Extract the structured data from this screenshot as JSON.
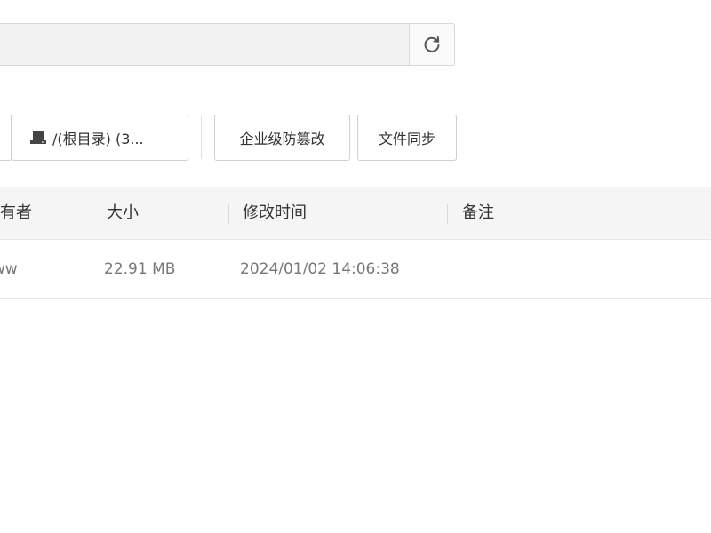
{
  "toolbar": {
    "refresh_icon": "refresh-icon",
    "root_drive_icon": "drive-icon",
    "root_label": "/(根目录) (3...",
    "enterprise_label": "企业级防篡改",
    "sync_label": "文件同步"
  },
  "table": {
    "headers": {
      "owner": "所有者",
      "size": "大小",
      "modified": "修改时间",
      "remark": "备注"
    },
    "rows": [
      {
        "owner": "www",
        "size": "22.91 MB",
        "modified": "2024/01/02 14:06:38",
        "remark": ""
      }
    ]
  },
  "colors": {
    "header_bg": "#f5f5f5",
    "border": "#d8d8d8",
    "muted_text": "#777777"
  }
}
